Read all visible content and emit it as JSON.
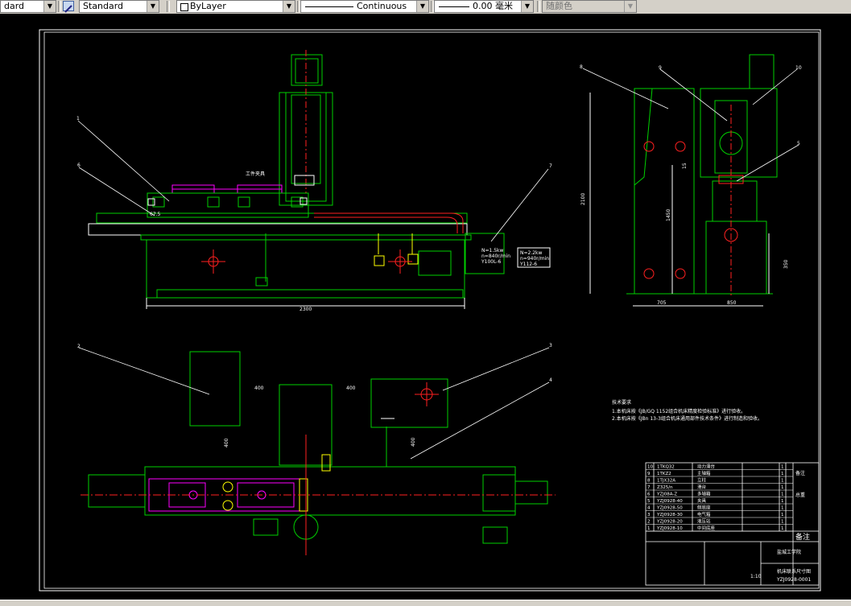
{
  "toolbar": {
    "text_style": "dard",
    "dim_style": "Standard",
    "layer": "ByLayer",
    "linetype": "Continuous",
    "lineweight": "0.00 毫米",
    "plot_style": "随颜色"
  },
  "drawing": {
    "front_view": {
      "work_fixture_label": "工件夹具",
      "dim_length": "2300",
      "dim_left": "67.5",
      "motor_left": {
        "power": "N=1.5kw",
        "speed": "n=840r/min",
        "model": "Y100L-6"
      },
      "motor_right": {
        "power": "N=2.2kw",
        "speed": "n=940r/min",
        "model": "Y112-6"
      },
      "balloons": [
        "1",
        "6",
        "7"
      ]
    },
    "side_view": {
      "dim_height": "2100",
      "dim_mid": "1450",
      "dim_top": "15",
      "dim_right": "350",
      "dim_bottom_left": "705",
      "dim_bottom_right": "850",
      "balloons": [
        "8",
        "9",
        "10",
        "5"
      ]
    },
    "top_view": {
      "dim_gap1": "400",
      "dim_gap2": "400",
      "dim_v1": "400",
      "dim_v2": "400",
      "balloons": [
        "2",
        "3",
        "4"
      ]
    },
    "notes": {
      "title": "技术要求",
      "line1": "1.本机床按《JB/GQ   1152组合机床精度检验标准》进行验收。",
      "line2": "2.本机床按《JBn 13-3组合机床通用部件技术条件》进行制造和验收。"
    },
    "bom": {
      "rows": [
        {
          "no": "10",
          "code": "1TKQ32",
          "name": "动力滑台",
          "qty": "1"
        },
        {
          "no": "9",
          "code": "1TKZ2",
          "name": "主轴箱",
          "qty": "1"
        },
        {
          "no": "8",
          "code": "1TJX32A",
          "name": "立柱",
          "qty": "1"
        },
        {
          "no": "7",
          "code": "Z325/n",
          "name": "滑台",
          "qty": "1"
        },
        {
          "no": "6",
          "code": "YZJ08A-Z",
          "name": "多轴箱",
          "qty": "1"
        },
        {
          "no": "5",
          "code": "YZJ0928-40",
          "name": "夹具",
          "qty": "1"
        },
        {
          "no": "4",
          "code": "YZJ0928-50",
          "name": "侧底座",
          "qty": "1"
        },
        {
          "no": "3",
          "code": "YZJ0928-30",
          "name": "电气箱",
          "qty": "1"
        },
        {
          "no": "2",
          "code": "YZJ0928-20",
          "name": "液压站",
          "qty": "1"
        },
        {
          "no": "1",
          "code": "YZJ0928-10",
          "name": "中间底座",
          "qty": "1"
        }
      ],
      "note_a": "备注",
      "note_b": "总重",
      "header_label": "备注",
      "school": "盐城工学院",
      "drawing_name": "机床联系尺寸图",
      "scale": "1:10",
      "drawing_no": "YZJ0928-0001"
    }
  },
  "colors": {
    "green": "#00d000",
    "white": "#ffffff",
    "magenta": "#ff00ff",
    "red": "#ff2020",
    "yellow": "#ffff00",
    "cyan": "#00ffff"
  }
}
